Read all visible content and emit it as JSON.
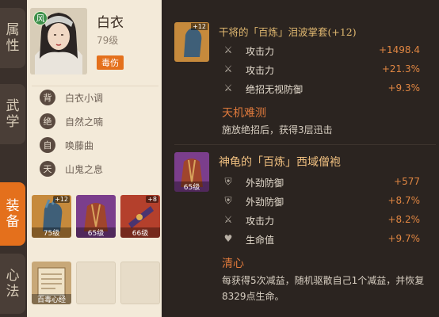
{
  "tabs": [
    "属性",
    "武学",
    "装备",
    "心法"
  ],
  "character": {
    "element_badge": "风",
    "name": "白衣",
    "level": "79级",
    "tag": "毒伤"
  },
  "skills": [
    {
      "seal": "背",
      "name": "白衣小调"
    },
    {
      "seal": "绝",
      "name": "自然之喃"
    },
    {
      "seal": "自",
      "name": "唤藤曲"
    },
    {
      "seal": "天",
      "name": "山鬼之息"
    }
  ],
  "gear": [
    {
      "level": "75级",
      "plus": "+12"
    },
    {
      "level": "65级",
      "plus": ""
    },
    {
      "level": "66级",
      "plus": "+8"
    }
  ],
  "book": {
    "label": "百毒心经"
  },
  "item1": {
    "title": "干将的「百炼」泪波掌套(+12)",
    "plus": "+12",
    "stats": [
      {
        "icon": "sword-icon",
        "label": "攻击力",
        "value": "+1498.4"
      },
      {
        "icon": "sword-icon",
        "label": "攻击力",
        "value": "+21.3%"
      },
      {
        "icon": "sword-icon",
        "label": "绝招无视防御",
        "value": "+9.3%"
      }
    ],
    "effect_name": "天机难测",
    "effect_desc": "施放绝招后，获得3层迅击"
  },
  "item2": {
    "title": "神龟的「百炼」西域僧袍",
    "level": "65级",
    "stats": [
      {
        "icon": "shield-icon",
        "label": "外劲防御",
        "value": "+577"
      },
      {
        "icon": "shield-icon",
        "label": "外劲防御",
        "value": "+8.7%"
      },
      {
        "icon": "sword-icon",
        "label": "攻击力",
        "value": "+8.2%"
      },
      {
        "icon": "heart-icon",
        "label": "生命值",
        "value": "+9.7%"
      }
    ],
    "effect_name": "清心",
    "effect_desc": "每获得5次减益，随机驱散自己1个减益，并恢复8329点生命。"
  },
  "colors": {
    "accent": "#e4701c",
    "value": "#e08642",
    "title1": "#e0b870",
    "title2": "#f0c080"
  }
}
